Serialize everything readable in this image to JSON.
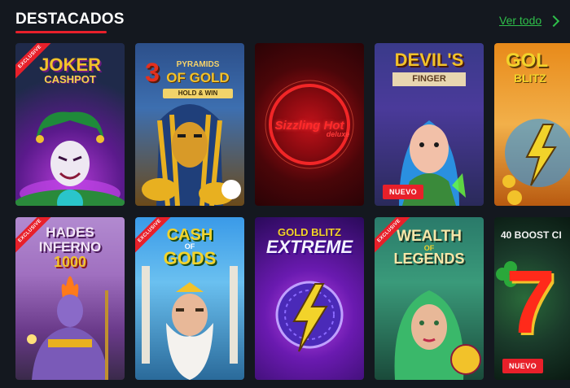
{
  "section": {
    "title": "DESTACADOS",
    "see_all_label": "Ver todo"
  },
  "row1": [
    {
      "name_line1": "JOKER",
      "name_line2": "CASHPOT",
      "ribbon": "EXCLUSIVE",
      "badge": ""
    },
    {
      "name_line1": "3",
      "name_line2": "PYRAMIDS",
      "name_line3": "OF GOLD",
      "name_line4": "HOLD & WIN",
      "ribbon": "",
      "badge": ""
    },
    {
      "name_line1": "Sizzling Hot",
      "name_line2": "deluxe",
      "ribbon": "",
      "badge": ""
    },
    {
      "name_line1": "DEVIL'S",
      "name_line2": "FINGER",
      "ribbon": "",
      "badge": "NUEVO"
    },
    {
      "name_line1": "GOL",
      "name_line2": "BLITZ",
      "ribbon": "",
      "badge": ""
    }
  ],
  "row2": [
    {
      "name_line1": "HADES",
      "name_line2": "INFERNO",
      "name_line3": "1000",
      "ribbon": "EXCLUSIVE",
      "badge": ""
    },
    {
      "name_line1": "CASH",
      "name_line2": "OF",
      "name_line3": "GODS",
      "ribbon": "EXCLUSIVE",
      "badge": ""
    },
    {
      "name_line1": "GOLD BLITZ",
      "name_line2": "EXTREME",
      "ribbon": "",
      "badge": ""
    },
    {
      "name_line1": "WEALTH",
      "name_line2": "OF",
      "name_line3": "LEGENDS",
      "ribbon": "EXCLUSIVE",
      "badge": ""
    },
    {
      "name_line1": "40 BOOST CI",
      "name_line2": "7",
      "ribbon": "",
      "badge": "NUEVO"
    }
  ]
}
